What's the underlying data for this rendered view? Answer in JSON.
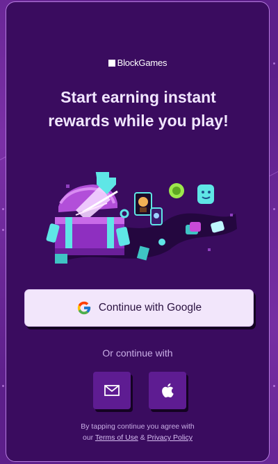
{
  "brand": {
    "name": "BlockGames"
  },
  "headline": {
    "line1": "Start earning instant",
    "line2": "rewards while you play!"
  },
  "hero": {
    "icon": "treasure-chest-illustration"
  },
  "google_button": {
    "label": "Continue with Google",
    "icon": "google-icon"
  },
  "alt_login": {
    "prompt": "Or continue with",
    "email_icon": "mail-icon",
    "apple_icon": "apple-icon"
  },
  "legal": {
    "prefix": "By tapping continue you agree with",
    "our": "our",
    "terms_label": "Terms of Use",
    "and": "&",
    "privacy_label": "Privacy Policy"
  },
  "colors": {
    "background": "#5c1f8a",
    "card": "#3a0c5f",
    "button_light": "#f2e6fb",
    "button_dark": "#5e1c92",
    "accent_cyan": "#5fe6e6",
    "accent_magenta": "#c84ad8"
  }
}
